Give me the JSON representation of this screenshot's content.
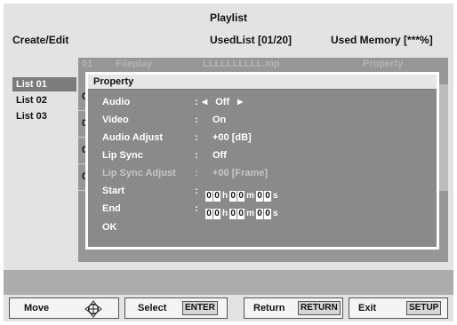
{
  "header": {
    "title": "Playlist",
    "create_edit": "Create/Edit",
    "used_list": "UsedList [01/20]",
    "used_memory": "Used Memory [***%]"
  },
  "side_list": [
    {
      "label": "List 01",
      "selected": true
    },
    {
      "label": "List 02",
      "selected": false
    },
    {
      "label": "List 03",
      "selected": false
    }
  ],
  "table": {
    "header": {
      "number": "01",
      "name": "Fileplay",
      "file": "LLLLLLLLLL.mp",
      "column": "Property"
    },
    "row_numbers": [
      "0",
      "0",
      "0",
      "0"
    ]
  },
  "dialog": {
    "title": "Property",
    "items": [
      {
        "label": "Audio",
        "value": "Off",
        "has_arrows": true,
        "disabled": false
      },
      {
        "label": "Video",
        "value": "On",
        "disabled": false
      },
      {
        "label": "Audio Adjust",
        "value": "+00 [dB]",
        "disabled": false
      },
      {
        "label": "Lip Sync",
        "value": "Off",
        "disabled": false
      },
      {
        "label": "Lip Sync Adjust",
        "value": "+00 [Frame]",
        "disabled": true
      }
    ],
    "start": {
      "label": "Start",
      "h": [
        "0",
        "0"
      ],
      "m": [
        "0",
        "0"
      ],
      "s": [
        "0",
        "0"
      ],
      "unit_h": "h",
      "unit_m": "m",
      "unit_s": "s"
    },
    "end": {
      "label": "End",
      "h": [
        "0",
        "0"
      ],
      "m": [
        "0",
        "0"
      ],
      "s": [
        "0",
        "0"
      ],
      "unit_h": "h",
      "unit_m": "m",
      "unit_s": "s"
    },
    "ok": "OK",
    "colon": ":"
  },
  "footer": {
    "move": "Move",
    "select": "Select",
    "select_key": "ENTER",
    "return": "Return",
    "return_key": "RETURN",
    "exit": "Exit",
    "exit_key": "SETUP"
  },
  "colors": {
    "screen_bg": "#e3e3e3",
    "dialog_bg": "#8a8a8a",
    "selection": "#7b7b7b",
    "table_bg": "#979797"
  }
}
